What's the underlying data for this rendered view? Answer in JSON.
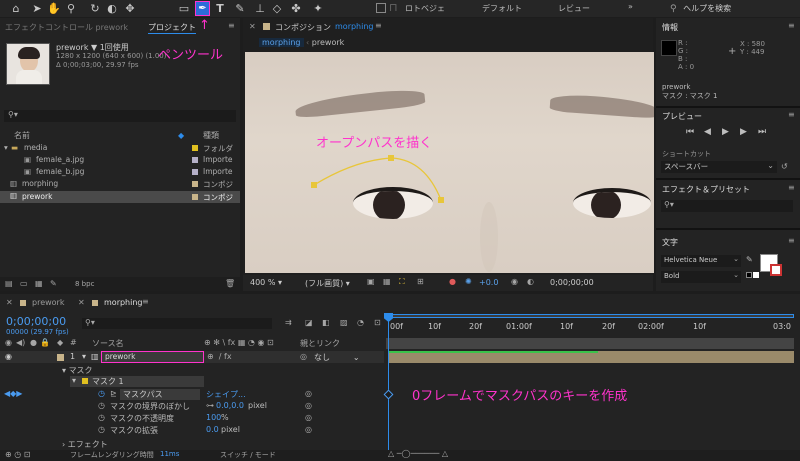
{
  "toolbar": {
    "workspaces": [
      "ロトベジェ",
      "デフォルト",
      "レビュー"
    ],
    "search_placeholder": "ヘルプを検索",
    "icons": [
      "home-icon",
      "selection-arrow-icon",
      "hand-icon",
      "zoom-icon",
      "rotate-icon",
      "camera-icon",
      "pan-behind-icon",
      "rectangle-icon",
      "pen-icon",
      "type-icon",
      "brush-icon",
      "clone-stamp-icon",
      "eraser-icon",
      "roto-brush-icon",
      "puppet-pin-icon"
    ]
  },
  "project_panel": {
    "tabs": [
      "エフェクトコントロール prework",
      "プロジェクト"
    ],
    "thumb_name": "prework ▼ 1回使用",
    "thumb_info1": "1280 x 1200  (640 x 600) (1.00)",
    "thumb_info2": "Δ 0;00;03;00, 29.97 fps",
    "search_placeholder": "⚲▾",
    "col_name": "名前",
    "col_type": "種類",
    "items": [
      {
        "name": "media",
        "type": "フォルダ"
      },
      {
        "name": "female_a.jpg",
        "type": "Importe"
      },
      {
        "name": "female_b.jpg",
        "type": "Importe"
      },
      {
        "name": "morphing",
        "type": "コンポジ"
      },
      {
        "name": "prework",
        "type": "コンポジ"
      }
    ],
    "bpc": "8 bpc"
  },
  "annotations": {
    "pen_tool": "ペンツール",
    "open_path": "オープンパスを描く",
    "keyframe": "0フレームでマスクパスのキーを作成"
  },
  "composition": {
    "title": "コンポジション",
    "name": "morphing",
    "breadcrumb": [
      "morphing",
      "prework"
    ],
    "zoom": "400 %",
    "quality": "(フル画質)",
    "exposure": "+0.0",
    "timecode": "0;00;00;00"
  },
  "info_panel": {
    "title": "情報",
    "rgba": [
      "R :",
      "G :",
      "B :",
      "A : 0"
    ],
    "x": "X : 580",
    "y": "Y : 449",
    "layer": "prework",
    "mask": "マスク : マスク 1"
  },
  "preview_panel": {
    "title": "プレビュー"
  },
  "shortcut": {
    "label": "ショートカット",
    "value": "スペースバー"
  },
  "effects_panel": {
    "title": "エフェクト＆プリセット",
    "search": "⚲▾"
  },
  "char_panel": {
    "title": "文字",
    "font": "Helvetica Neue",
    "style": "Bold"
  },
  "timeline": {
    "tabs": [
      "prework",
      "morphing"
    ],
    "timecode": "0;00;00;00",
    "fps": "00000 (29.97 fps)",
    "col_source": "ソース名",
    "col_parent": "親とリンク",
    "ruler": [
      "00f",
      "10f",
      "20f",
      "01:00f",
      "10f",
      "20f",
      "02:00f",
      "10f",
      "03:0"
    ],
    "layer": {
      "num": "1",
      "name": "prework",
      "parent": "なし"
    },
    "props": [
      {
        "name": "マスク"
      },
      {
        "name": "マスク 1"
      },
      {
        "name": "マスクパス",
        "value": "シェイプ..."
      },
      {
        "name": "マスクの境界のぼかし",
        "value": "0.0,0.0",
        "unit": "pixel"
      },
      {
        "name": "マスクの不透明度",
        "value": "100",
        "unit": "%"
      },
      {
        "name": "マスクの拡張",
        "value": "0.0",
        "unit": "pixel"
      },
      {
        "name": "エフェクト"
      }
    ],
    "footer_render": "フレームレンダリング時間",
    "footer_ms": "11ms",
    "footer_mode": "スイッチ / モード"
  },
  "colors": {
    "accent": "#2d8ceb",
    "annotation": "#ff33cc",
    "mask_path": "#e8c63a",
    "label_tan": "#c8b48a"
  }
}
